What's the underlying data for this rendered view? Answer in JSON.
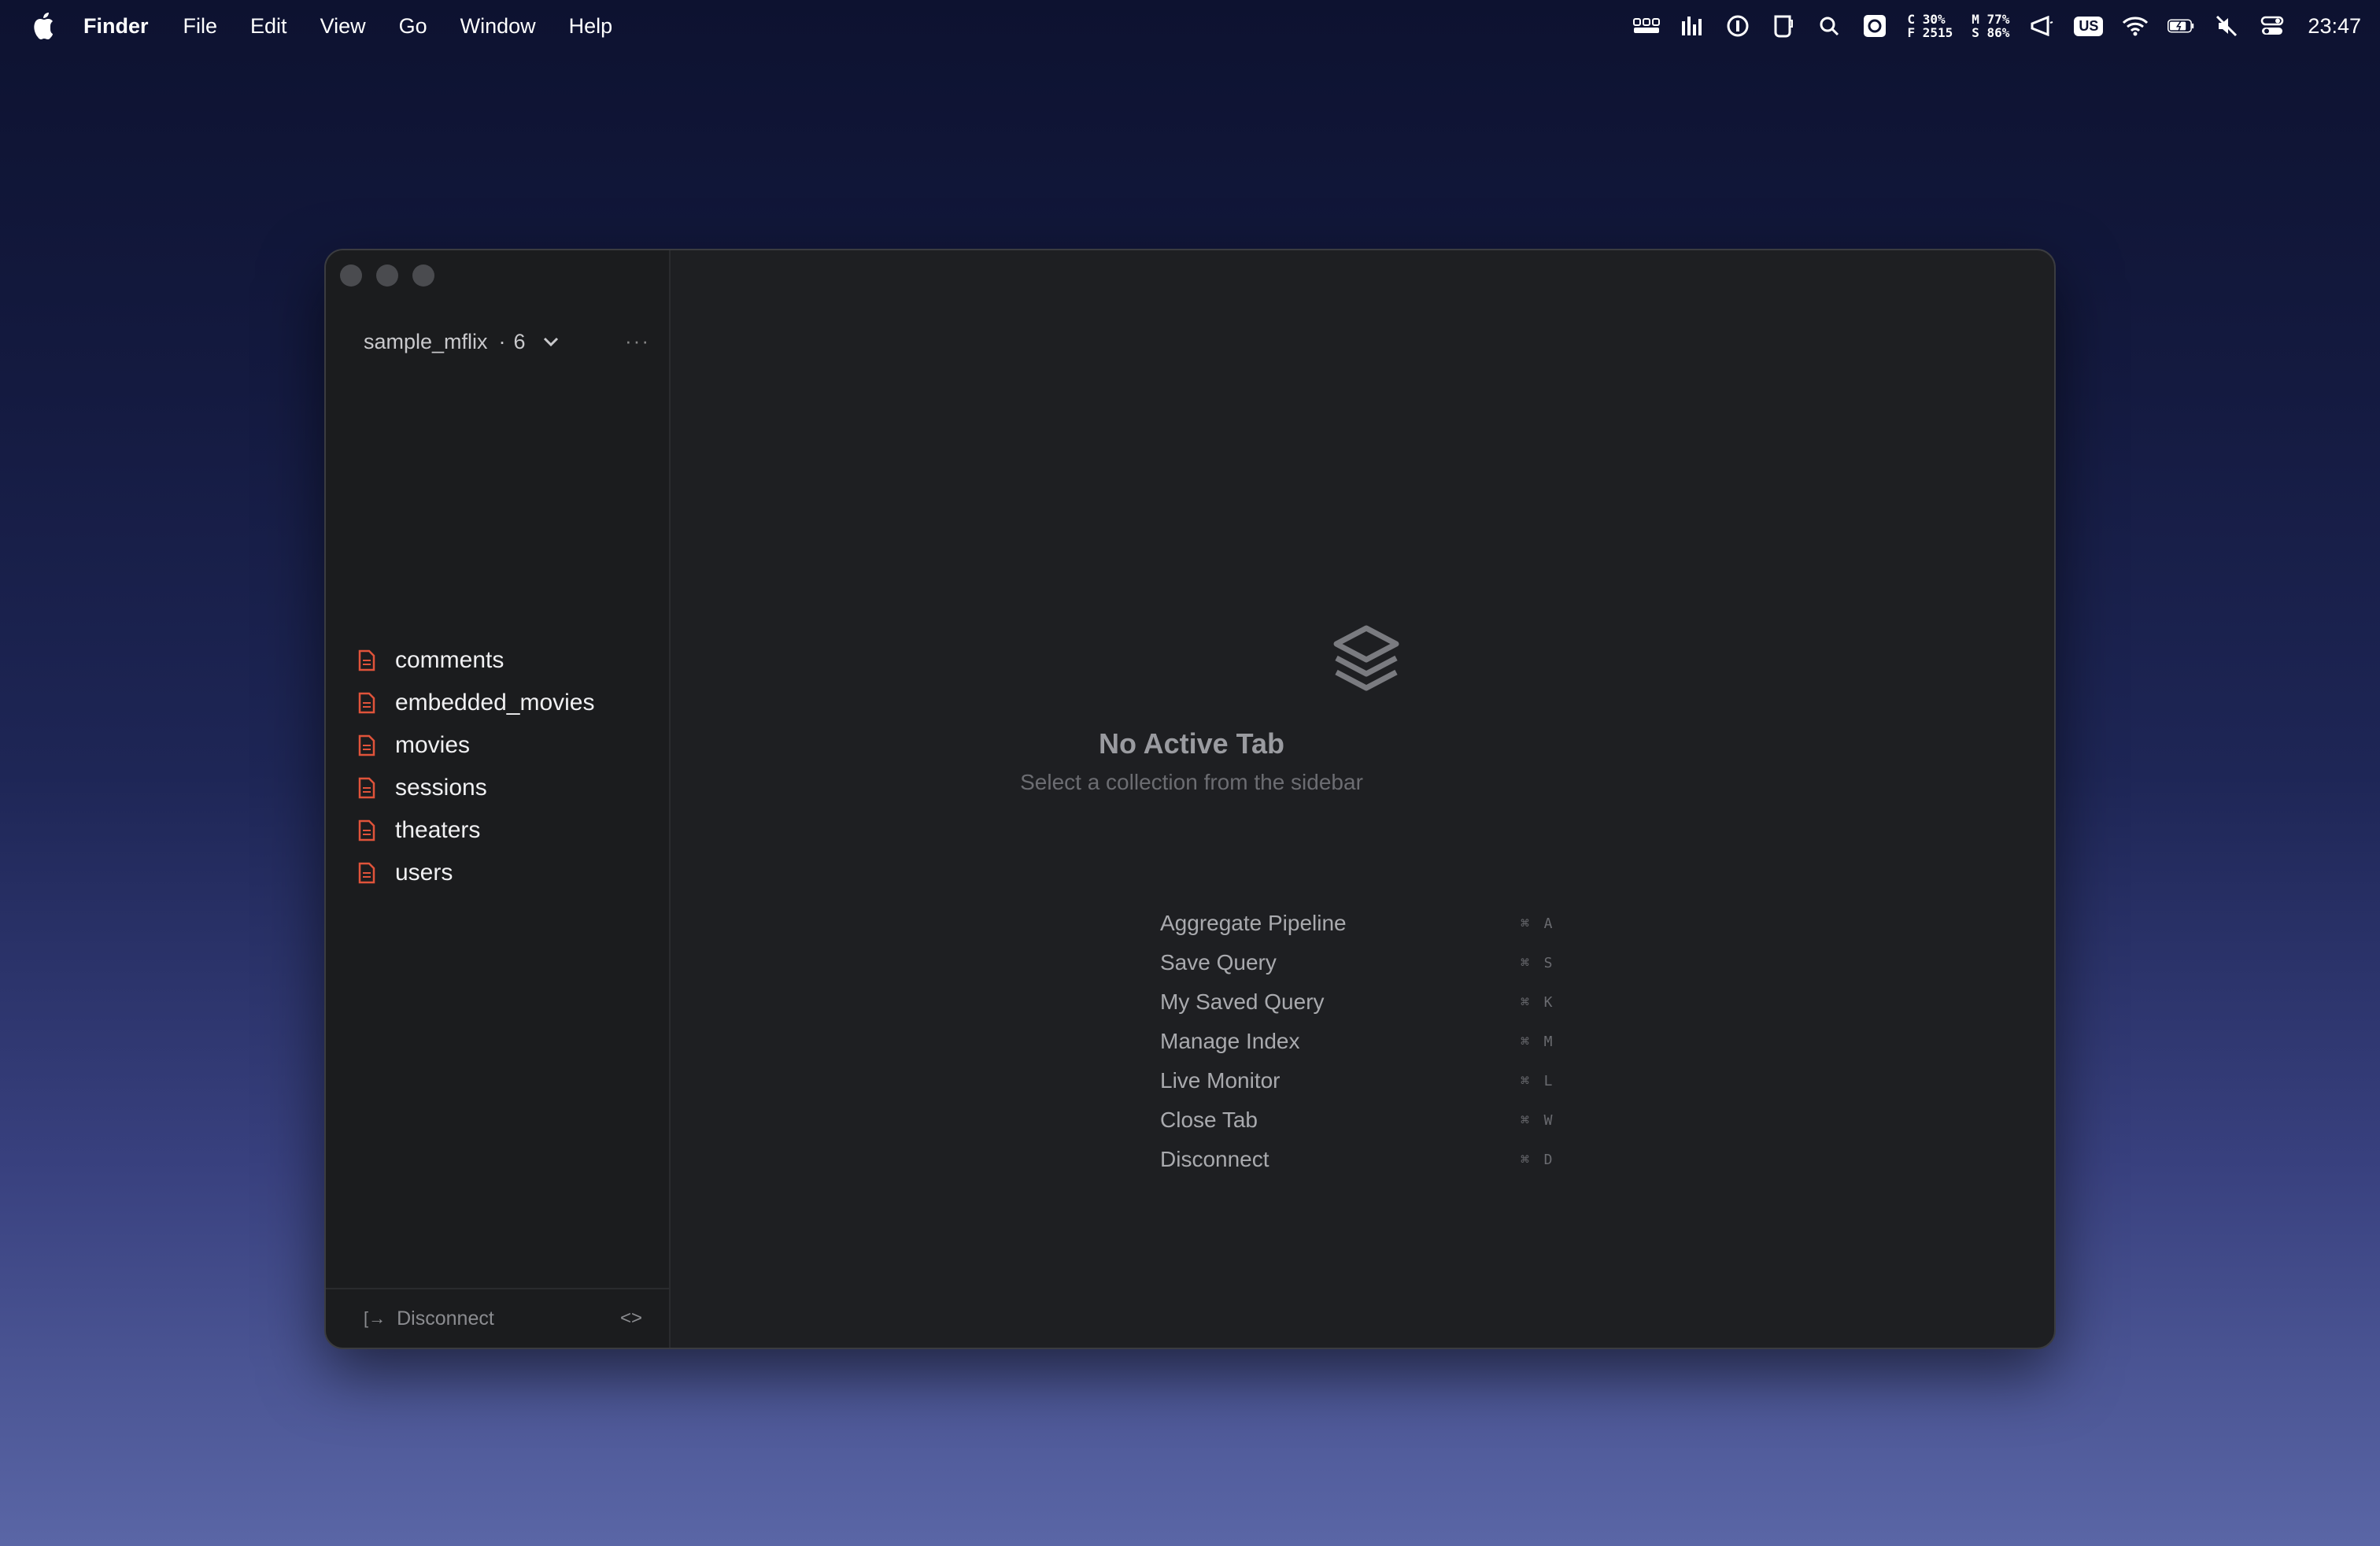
{
  "menubar": {
    "app_name": "Finder",
    "items": [
      "File",
      "Edit",
      "View",
      "Go",
      "Window",
      "Help"
    ],
    "cpu_stats": "C 30%\nF 2515",
    "mem_stats": "M 77%\nS 86%",
    "keyboard_layout": "US",
    "clock": "23:47"
  },
  "sidebar": {
    "database": "sample_mflix",
    "separator": "·",
    "collection_count": "6",
    "collections": [
      "comments",
      "embedded_movies",
      "movies",
      "sessions",
      "theaters",
      "users"
    ],
    "footer_disconnect": "Disconnect"
  },
  "main": {
    "empty_title": "No Active Tab",
    "empty_subtitle": "Select a collection from the sidebar",
    "shortcuts": [
      {
        "label": "Aggregate Pipeline",
        "key": "⌘ A"
      },
      {
        "label": "Save Query",
        "key": "⌘ S"
      },
      {
        "label": "My Saved Query",
        "key": "⌘ K"
      },
      {
        "label": "Manage Index",
        "key": "⌘ M"
      },
      {
        "label": "Live Monitor",
        "key": "⌘ L"
      },
      {
        "label": "Close Tab",
        "key": "⌘ W"
      },
      {
        "label": "Disconnect",
        "key": "⌘ D"
      }
    ]
  },
  "colors": {
    "collection_icon": "#e0533a",
    "window_bg": "#1e1f22"
  }
}
